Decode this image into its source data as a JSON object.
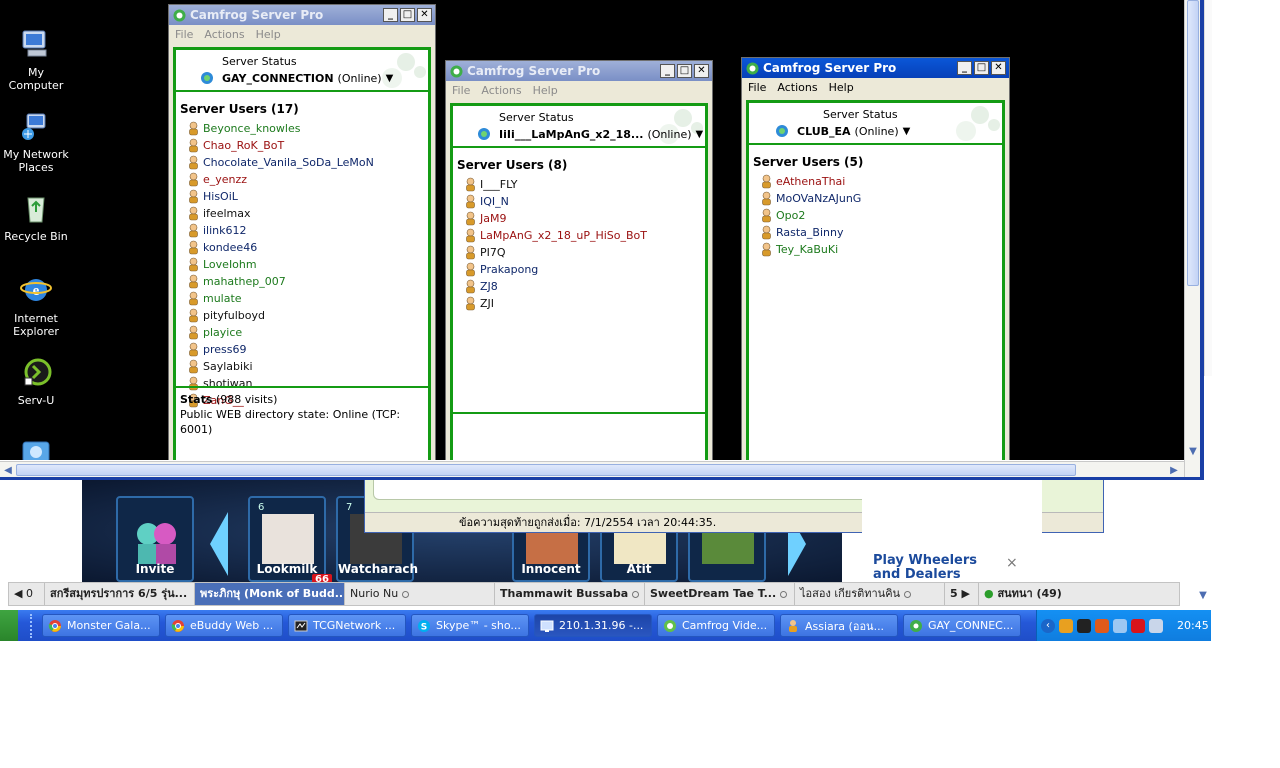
{
  "desktop_icons": [
    {
      "label": "My Computer",
      "icon": "computer-icon"
    },
    {
      "label": "My Network Places",
      "icon": "network-icon"
    },
    {
      "label": "Recycle Bin",
      "icon": "recycle-bin-icon"
    },
    {
      "label": "Internet Explorer",
      "icon": "ie-icon"
    },
    {
      "label": "Serv-U",
      "icon": "servu-icon"
    }
  ],
  "windows": [
    {
      "title": "Camfrog Server Pro",
      "menu": [
        "File",
        "Actions",
        "Help"
      ],
      "status_label": "Server Status",
      "server_name": "GAY_CONNECTION",
      "server_state": "(Online)",
      "users_heading": "Server Users (17)",
      "users": [
        {
          "name": "Beyonce_knowles",
          "color": "green"
        },
        {
          "name": "Chao_RoK_BoT",
          "color": "red"
        },
        {
          "name": "Chocolate_Vanila_SoDa_LeMoN",
          "color": "blue"
        },
        {
          "name": "e_yenzz",
          "color": "red"
        },
        {
          "name": "HisOiL",
          "color": "blue"
        },
        {
          "name": "ifeelmax",
          "color": "black"
        },
        {
          "name": "ilink612",
          "color": "blue"
        },
        {
          "name": "kondee46",
          "color": "blue"
        },
        {
          "name": "LoveIohm",
          "color": "green"
        },
        {
          "name": "mahathep_007",
          "color": "green"
        },
        {
          "name": "mulate",
          "color": "green"
        },
        {
          "name": "pityfulboyd",
          "color": "black"
        },
        {
          "name": "playice",
          "color": "green"
        },
        {
          "name": "press69",
          "color": "blue"
        },
        {
          "name": "Saylabiki",
          "color": "black"
        },
        {
          "name": "shotiwan",
          "color": "black"
        },
        {
          "name": "ZanG__",
          "color": "red"
        }
      ],
      "stats_label": "Stats",
      "stats_visits": "(988 visits)",
      "stats_line": "Public WEB directory state: Online (TCP: 6001)"
    },
    {
      "title": "Camfrog Server Pro",
      "menu": [
        "File",
        "Actions",
        "Help"
      ],
      "status_label": "Server Status",
      "server_name": "IiIi___LaMpAnG_x2_18...",
      "server_state": "(Online)",
      "users_heading": "Server Users (8)",
      "users": [
        {
          "name": "I___FLY",
          "color": "black"
        },
        {
          "name": "IQI_N",
          "color": "blue"
        },
        {
          "name": "JaM9",
          "color": "red"
        },
        {
          "name": "LaMpAnG_x2_18_uP_HiSo_BoT",
          "color": "red"
        },
        {
          "name": "PI7Q",
          "color": "black"
        },
        {
          "name": "Prakapong",
          "color": "blue"
        },
        {
          "name": "ZJ8",
          "color": "blue"
        },
        {
          "name": "ZJI",
          "color": "black"
        }
      ]
    },
    {
      "title": "Camfrog Server Pro",
      "menu": [
        "File",
        "Actions",
        "Help"
      ],
      "status_label": "Server Status",
      "server_name": "CLUB_EA",
      "server_state": "(Online)",
      "users_heading": "Server Users (5)",
      "users": [
        {
          "name": "eAthenaThai",
          "color": "red"
        },
        {
          "name": "MoOVaNzAJunG",
          "color": "blue"
        },
        {
          "name": "Opo2",
          "color": "green"
        },
        {
          "name": "Rasta_Binny",
          "color": "blue"
        },
        {
          "name": "Tey_KaBuKi",
          "color": "green"
        }
      ]
    }
  ],
  "game": {
    "tiles": [
      {
        "name": "Invite",
        "num": ""
      },
      {
        "name": "Lookmilk",
        "num": "6"
      },
      {
        "name": "Watcharach",
        "num": "7"
      },
      {
        "name": "Innocent",
        "num": ""
      },
      {
        "name": "Atit",
        "num": ""
      }
    ],
    "badge": "66"
  },
  "chat": {
    "last_message": "ข้อความสุดท้ายถูกส่งเมื่อ: 7/1/2554 เวลา 20:44:35."
  },
  "ad": {
    "title": "Play Wheelers and Dealers",
    "close": "×"
  },
  "tabs": [
    {
      "label": "◀ 0"
    },
    {
      "label": "สกรีสมุทรปราการ 6/5 รุ่น..."
    },
    {
      "label": "พระภิกษุ (Monk of Budd..."
    },
    {
      "label": "Nurio Nu"
    },
    {
      "label": "Thammawit Bussaba"
    },
    {
      "label": "SweetDream Tae T..."
    },
    {
      "label": "ไอสอง เกียรติทานคิน"
    },
    {
      "label": "5 ▶"
    },
    {
      "label": "สนทนา (49)"
    }
  ],
  "taskbar": {
    "buttons": [
      {
        "label": "Monster Gala...",
        "icon": "chrome-icon"
      },
      {
        "label": "eBuddy Web ...",
        "icon": "chrome-icon"
      },
      {
        "label": "TCGNetwork ...",
        "icon": "app-icon"
      },
      {
        "label": "Skype™ - sho...",
        "icon": "skype-icon"
      },
      {
        "label": "210.1.31.96 -...",
        "icon": "remote-desktop-icon"
      },
      {
        "label": "Camfrog Vide...",
        "icon": "camfrog-icon"
      },
      {
        "label": "Assiara (ออน...",
        "icon": "user-icon"
      },
      {
        "label": "GAY_CONNEC...",
        "icon": "camfrog-server-icon"
      }
    ],
    "clock": "20:45"
  },
  "colors": {
    "green_border": "#149b14",
    "title_active": "#0a57d8",
    "taskbar": "#2558d8"
  }
}
